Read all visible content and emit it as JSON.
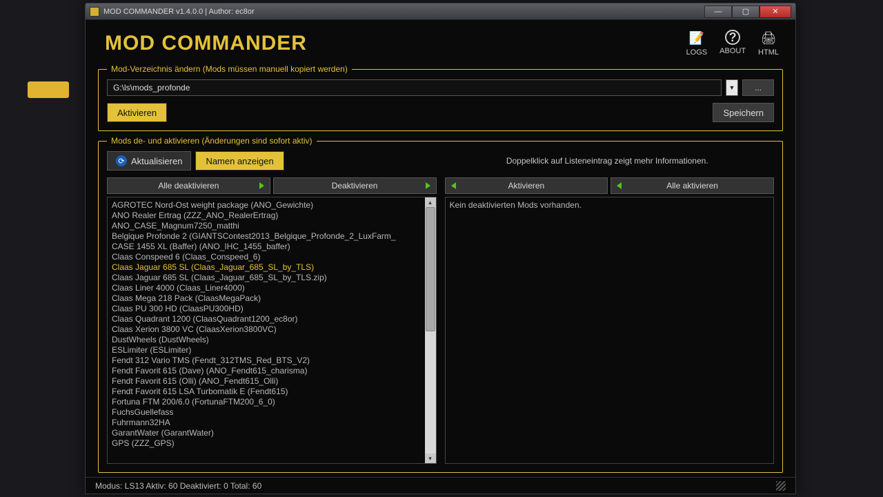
{
  "titlebar": {
    "title": "MOD COMMANDER v1.4.0.0 | Author: ec8or",
    "min": "—",
    "max": "▢",
    "close": "✕"
  },
  "header": {
    "brand": "MOD COMMANDER",
    "tools": {
      "logs": "LOGS",
      "about": "ABOUT",
      "html": "HTML"
    },
    "icons": {
      "logs": "📝",
      "about": "?",
      "html": "🖨"
    }
  },
  "dir_group": {
    "legend": "Mod-Verzeichnis ändern (Mods müssen manuell kopiert werden)",
    "path": "G:\\ls\\mods_profonde",
    "browse": "...",
    "activate": "Aktivieren",
    "save": "Speichern"
  },
  "mods_group": {
    "legend": "Mods de- und aktivieren (Änderungen sind sofort aktiv)",
    "refresh": "Aktualisieren",
    "shownames": "Namen anzeigen",
    "hint": "Doppelklick auf Listeneintrag zeigt mehr Informationen.",
    "left_actions": {
      "all_deact": "Alle deaktivieren",
      "deact": "Deaktivieren"
    },
    "right_actions": {
      "act": "Aktivieren",
      "all_act": "Alle aktivieren"
    },
    "right_empty": "Kein deaktivierten Mods vorhanden.",
    "active_list": [
      "AGROTEC Nord-Ost weight package (ANO_Gewichte)",
      "ANO Realer Ertrag (ZZZ_ANO_RealerErtrag)",
      "ANO_CASE_Magnum7250_matthi",
      "Belgique Profonde 2 (GIANTSContest2013_Belgique_Profonde_2_LuxFarm_",
      "CASE 1455 XL (Baffer) (ANO_IHC_1455_baffer)",
      "Claas Conspeed 6 (Claas_Conspeed_6)",
      "Claas Jaguar 685 SL (Claas_Jaguar_685_SL_by_TLS)",
      "Claas Jaguar 685 SL (Claas_Jaguar_685_SL_by_TLS.zip)",
      "Claas Liner 4000 (Claas_Liner4000)",
      "Claas Mega 218 Pack (ClaasMegaPack)",
      "Claas PU 300 HD (ClaasPU300HD)",
      "Claas Quadrant 1200 (ClaasQuadrant1200_ec8or)",
      "Claas Xerion 3800 VC (ClaasXerion3800VC)",
      "DustWheels (DustWheels)",
      "ESLimiter (ESLimiter)",
      "Fendt 312 Vario TMS (Fendt_312TMS_Red_BTS_V2)",
      "Fendt Favorit 615 (Dave) (ANO_Fendt615_charisma)",
      "Fendt Favorit 615 (Olli) (ANO_Fendt615_Olli)",
      "Fendt Favorit 615 LSA Turbomatik E (Fendt615)",
      "Fortuna FTM 200/6.0 (FortunaFTM200_6_0)",
      "FuchsGuellefass",
      "Fuhrmann32HA",
      "GarantWater (GarantWater)",
      "GPS (ZZZ_GPS)"
    ],
    "selected_index": 6
  },
  "statusbar": {
    "text": "Modus: LS13   Aktiv: 60   Deaktiviert: 0   Total: 60"
  }
}
